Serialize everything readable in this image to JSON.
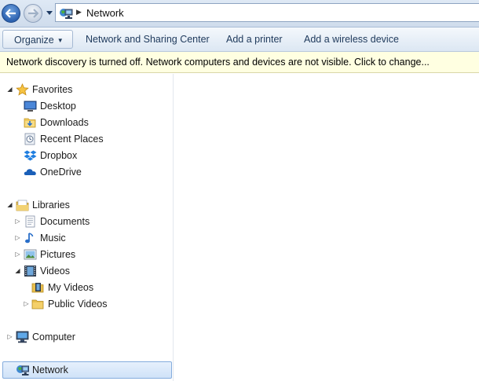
{
  "address_bar": {
    "location": "Network"
  },
  "toolbar": {
    "organize_label": "Organize",
    "sharing_center_label": "Network and Sharing Center",
    "add_printer_label": "Add a printer",
    "add_wireless_label": "Add a wireless device"
  },
  "infobar": {
    "message": "Network discovery is turned off. Network computers and devices are not visible. Click to change..."
  },
  "nav": {
    "favorites": {
      "label": "Favorites",
      "items": [
        {
          "label": "Desktop",
          "icon": "desktop-icon"
        },
        {
          "label": "Downloads",
          "icon": "downloads-icon"
        },
        {
          "label": "Recent Places",
          "icon": "recent-places-icon"
        },
        {
          "label": "Dropbox",
          "icon": "dropbox-icon"
        },
        {
          "label": "OneDrive",
          "icon": "onedrive-icon"
        }
      ]
    },
    "libraries": {
      "label": "Libraries",
      "items": [
        {
          "label": "Documents",
          "icon": "documents-icon"
        },
        {
          "label": "Music",
          "icon": "music-icon"
        },
        {
          "label": "Pictures",
          "icon": "pictures-icon"
        },
        {
          "label": "Videos",
          "icon": "videos-icon"
        }
      ],
      "videos_children": [
        {
          "label": "My Videos",
          "icon": "folder-video-icon"
        },
        {
          "label": "Public Videos",
          "icon": "folder-icon"
        }
      ]
    },
    "computer": {
      "label": "Computer",
      "icon": "computer-icon"
    },
    "network": {
      "label": "Network",
      "icon": "network-icon",
      "selected": true
    }
  },
  "colors": {
    "infobar_bg": "#ffffe1",
    "selection_border": "#84acdd",
    "toolbar_text": "#1e395b"
  }
}
